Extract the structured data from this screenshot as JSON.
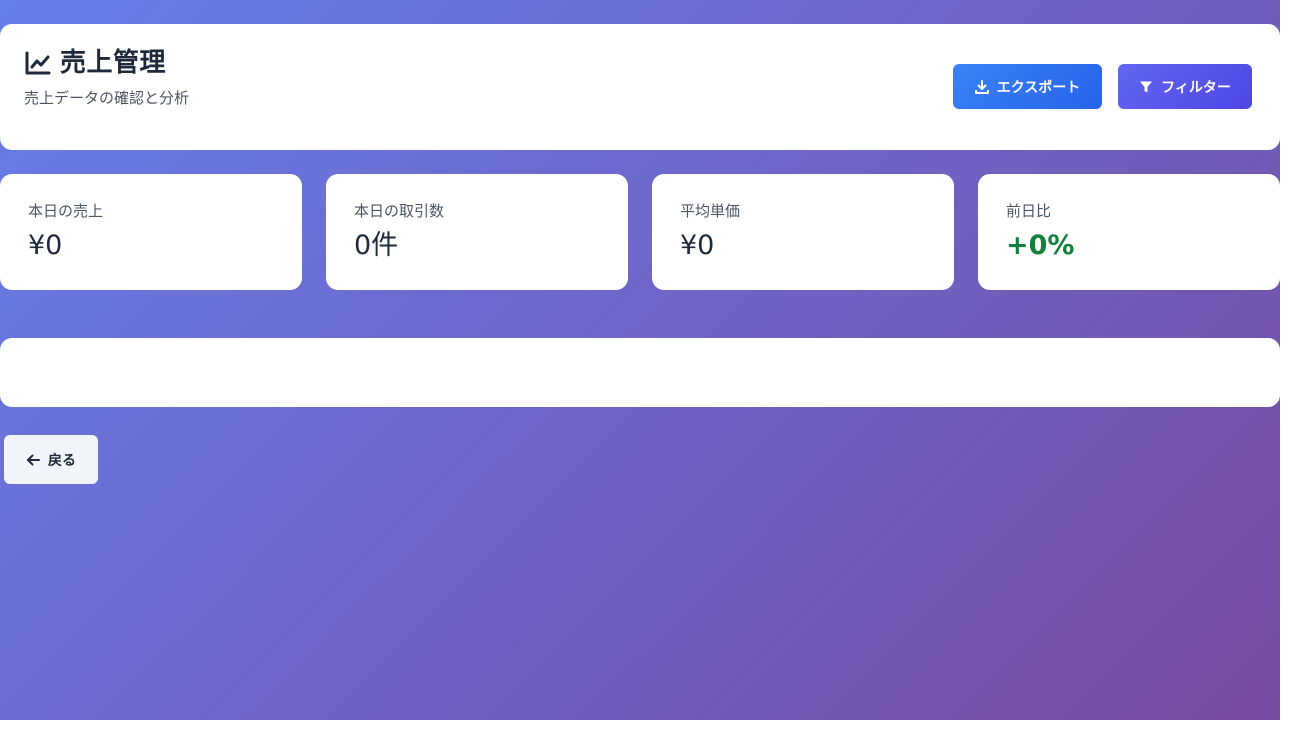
{
  "header": {
    "title": "売上管理",
    "subtitle": "売上データの確認と分析",
    "title_icon": "chart-line-icon"
  },
  "actions": {
    "export_label": "エクスポート",
    "export_icon": "download-icon",
    "filter_label": "フィルター",
    "filter_icon": "filter-icon"
  },
  "stats": [
    {
      "label": "本日の売上",
      "value": "¥0"
    },
    {
      "label": "本日の取引数",
      "value": "0件"
    },
    {
      "label": "平均単価",
      "value": "¥0"
    },
    {
      "label": "前日比",
      "value": "+0%"
    }
  ],
  "back": {
    "label": "戻る",
    "icon": "arrow-left-icon"
  },
  "colors": {
    "background_start": "#667eea",
    "background_end": "#764ba2",
    "export_button": "#3b82f6",
    "filter_button": "#6366f1",
    "positive_change": "#15803d"
  }
}
